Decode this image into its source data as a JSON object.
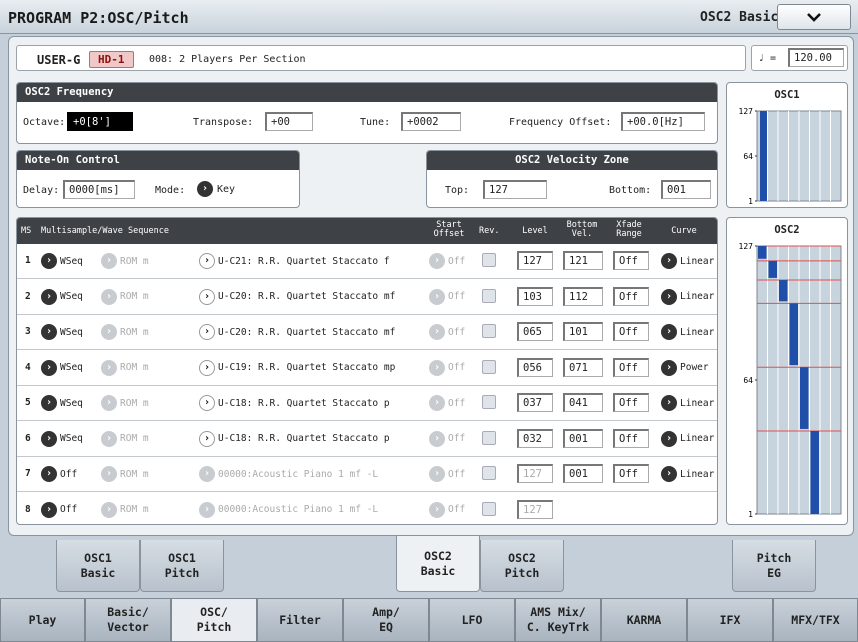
{
  "header": {
    "title": "PROGRAM P2:OSC/Pitch",
    "page": "OSC2 Basic"
  },
  "program": {
    "bank": "USER-G",
    "hd": "HD-1",
    "name": "008: 2 Players Per Section",
    "tempo_symbol": "♩ =",
    "tempo": "120.00"
  },
  "freq": {
    "title": "OSC2 Frequency",
    "octave_label": "Octave:",
    "octave": "+0[8']",
    "transpose_label": "Transpose:",
    "transpose": "+00",
    "tune_label": "Tune:",
    "tune": "+0002",
    "offset_label": "Frequency Offset:",
    "offset": "+00.0[Hz]"
  },
  "noteon": {
    "title": "Note-On Control",
    "delay_label": "Delay:",
    "delay": "0000[ms]",
    "mode_label": "Mode:",
    "mode": "Key"
  },
  "velzone": {
    "title": "OSC2 Velocity Zone",
    "top_label": "Top:",
    "top": "127",
    "bottom_label": "Bottom:",
    "bottom": "001"
  },
  "table": {
    "headers": {
      "ms": "MS",
      "wave": "Multisample/Wave Sequence",
      "start": "Start\nOffset",
      "rev": "Rev.",
      "level": "Level",
      "bvel": "Bottom\nVel.",
      "xfade": "Xfade\nRange",
      "curve": "Curve"
    },
    "rows": [
      {
        "n": "1",
        "type": "WSeq",
        "rom": "ROM m",
        "wave": "U-C21: R.R. Quartet Staccato f",
        "start": "Off",
        "level": "127",
        "bvel": "121",
        "xfade": "Off",
        "curve": "Linear",
        "dim": false
      },
      {
        "n": "2",
        "type": "WSeq",
        "rom": "ROM m",
        "wave": "U-C20: R.R. Quartet Staccato mf",
        "start": "Off",
        "level": "103",
        "bvel": "112",
        "xfade": "Off",
        "curve": "Linear",
        "dim": false
      },
      {
        "n": "3",
        "type": "WSeq",
        "rom": "ROM m",
        "wave": "U-C20: R.R. Quartet Staccato mf",
        "start": "Off",
        "level": "065",
        "bvel": "101",
        "xfade": "Off",
        "curve": "Linear",
        "dim": false
      },
      {
        "n": "4",
        "type": "WSeq",
        "rom": "ROM m",
        "wave": "U-C19: R.R. Quartet Staccato mp",
        "start": "Off",
        "level": "056",
        "bvel": "071",
        "xfade": "Off",
        "curve": "Power",
        "dim": false
      },
      {
        "n": "5",
        "type": "WSeq",
        "rom": "ROM m",
        "wave": "U-C18: R.R. Quartet Staccato p",
        "start": "Off",
        "level": "037",
        "bvel": "041",
        "xfade": "Off",
        "curve": "Linear",
        "dim": false
      },
      {
        "n": "6",
        "type": "WSeq",
        "rom": "ROM m",
        "wave": "U-C18: R.R. Quartet Staccato p",
        "start": "Off",
        "level": "032",
        "bvel": "001",
        "xfade": "Off",
        "curve": "Linear",
        "dim": false
      },
      {
        "n": "7",
        "type": "Off",
        "rom": "ROM m",
        "wave": "00000:Acoustic Piano 1 mf -L",
        "start": "Off",
        "level": "127",
        "bvel": "001",
        "xfade": "Off",
        "curve": "Linear",
        "dim": true
      },
      {
        "n": "8",
        "type": "Off",
        "rom": "ROM m",
        "wave": "00000:Acoustic Piano 1 mf -L",
        "start": "Off",
        "level": "127",
        "bvel": "",
        "xfade": "",
        "curve": "",
        "dim": true
      }
    ]
  },
  "osc1_graph": {
    "title": "OSC1",
    "y_labels": [
      "127",
      "64",
      "1"
    ],
    "bars": [
      {
        "bottom_vel": 1,
        "top_vel": 127
      }
    ]
  },
  "osc2_graph": {
    "title": "OSC2",
    "y_labels": [
      "127",
      "64",
      "1"
    ],
    "bars": [
      {
        "top_vel": 127,
        "bottom_vel": 121
      },
      {
        "top_vel": 120,
        "bottom_vel": 112
      },
      {
        "top_vel": 111,
        "bottom_vel": 101
      },
      {
        "top_vel": 100,
        "bottom_vel": 71
      },
      {
        "top_vel": 70,
        "bottom_vel": 41
      },
      {
        "top_vel": 40,
        "bottom_vel": 1
      }
    ]
  },
  "subtabs": [
    "OSC1\nBasic",
    "OSC1\nPitch",
    "OSC2\nBasic",
    "OSC2\nPitch",
    "Pitch\nEG"
  ],
  "bottomtabs": [
    "Play",
    "Basic/\nVector",
    "OSC/\nPitch",
    "Filter",
    "Amp/\nEQ",
    "LFO",
    "AMS Mix/\nC. KeyTrk",
    "KARMA",
    "IFX",
    "MFX/TFX"
  ],
  "colors": {
    "bar": "#1f4fa8",
    "header": "#3e4246",
    "accent_red": "#901010"
  }
}
